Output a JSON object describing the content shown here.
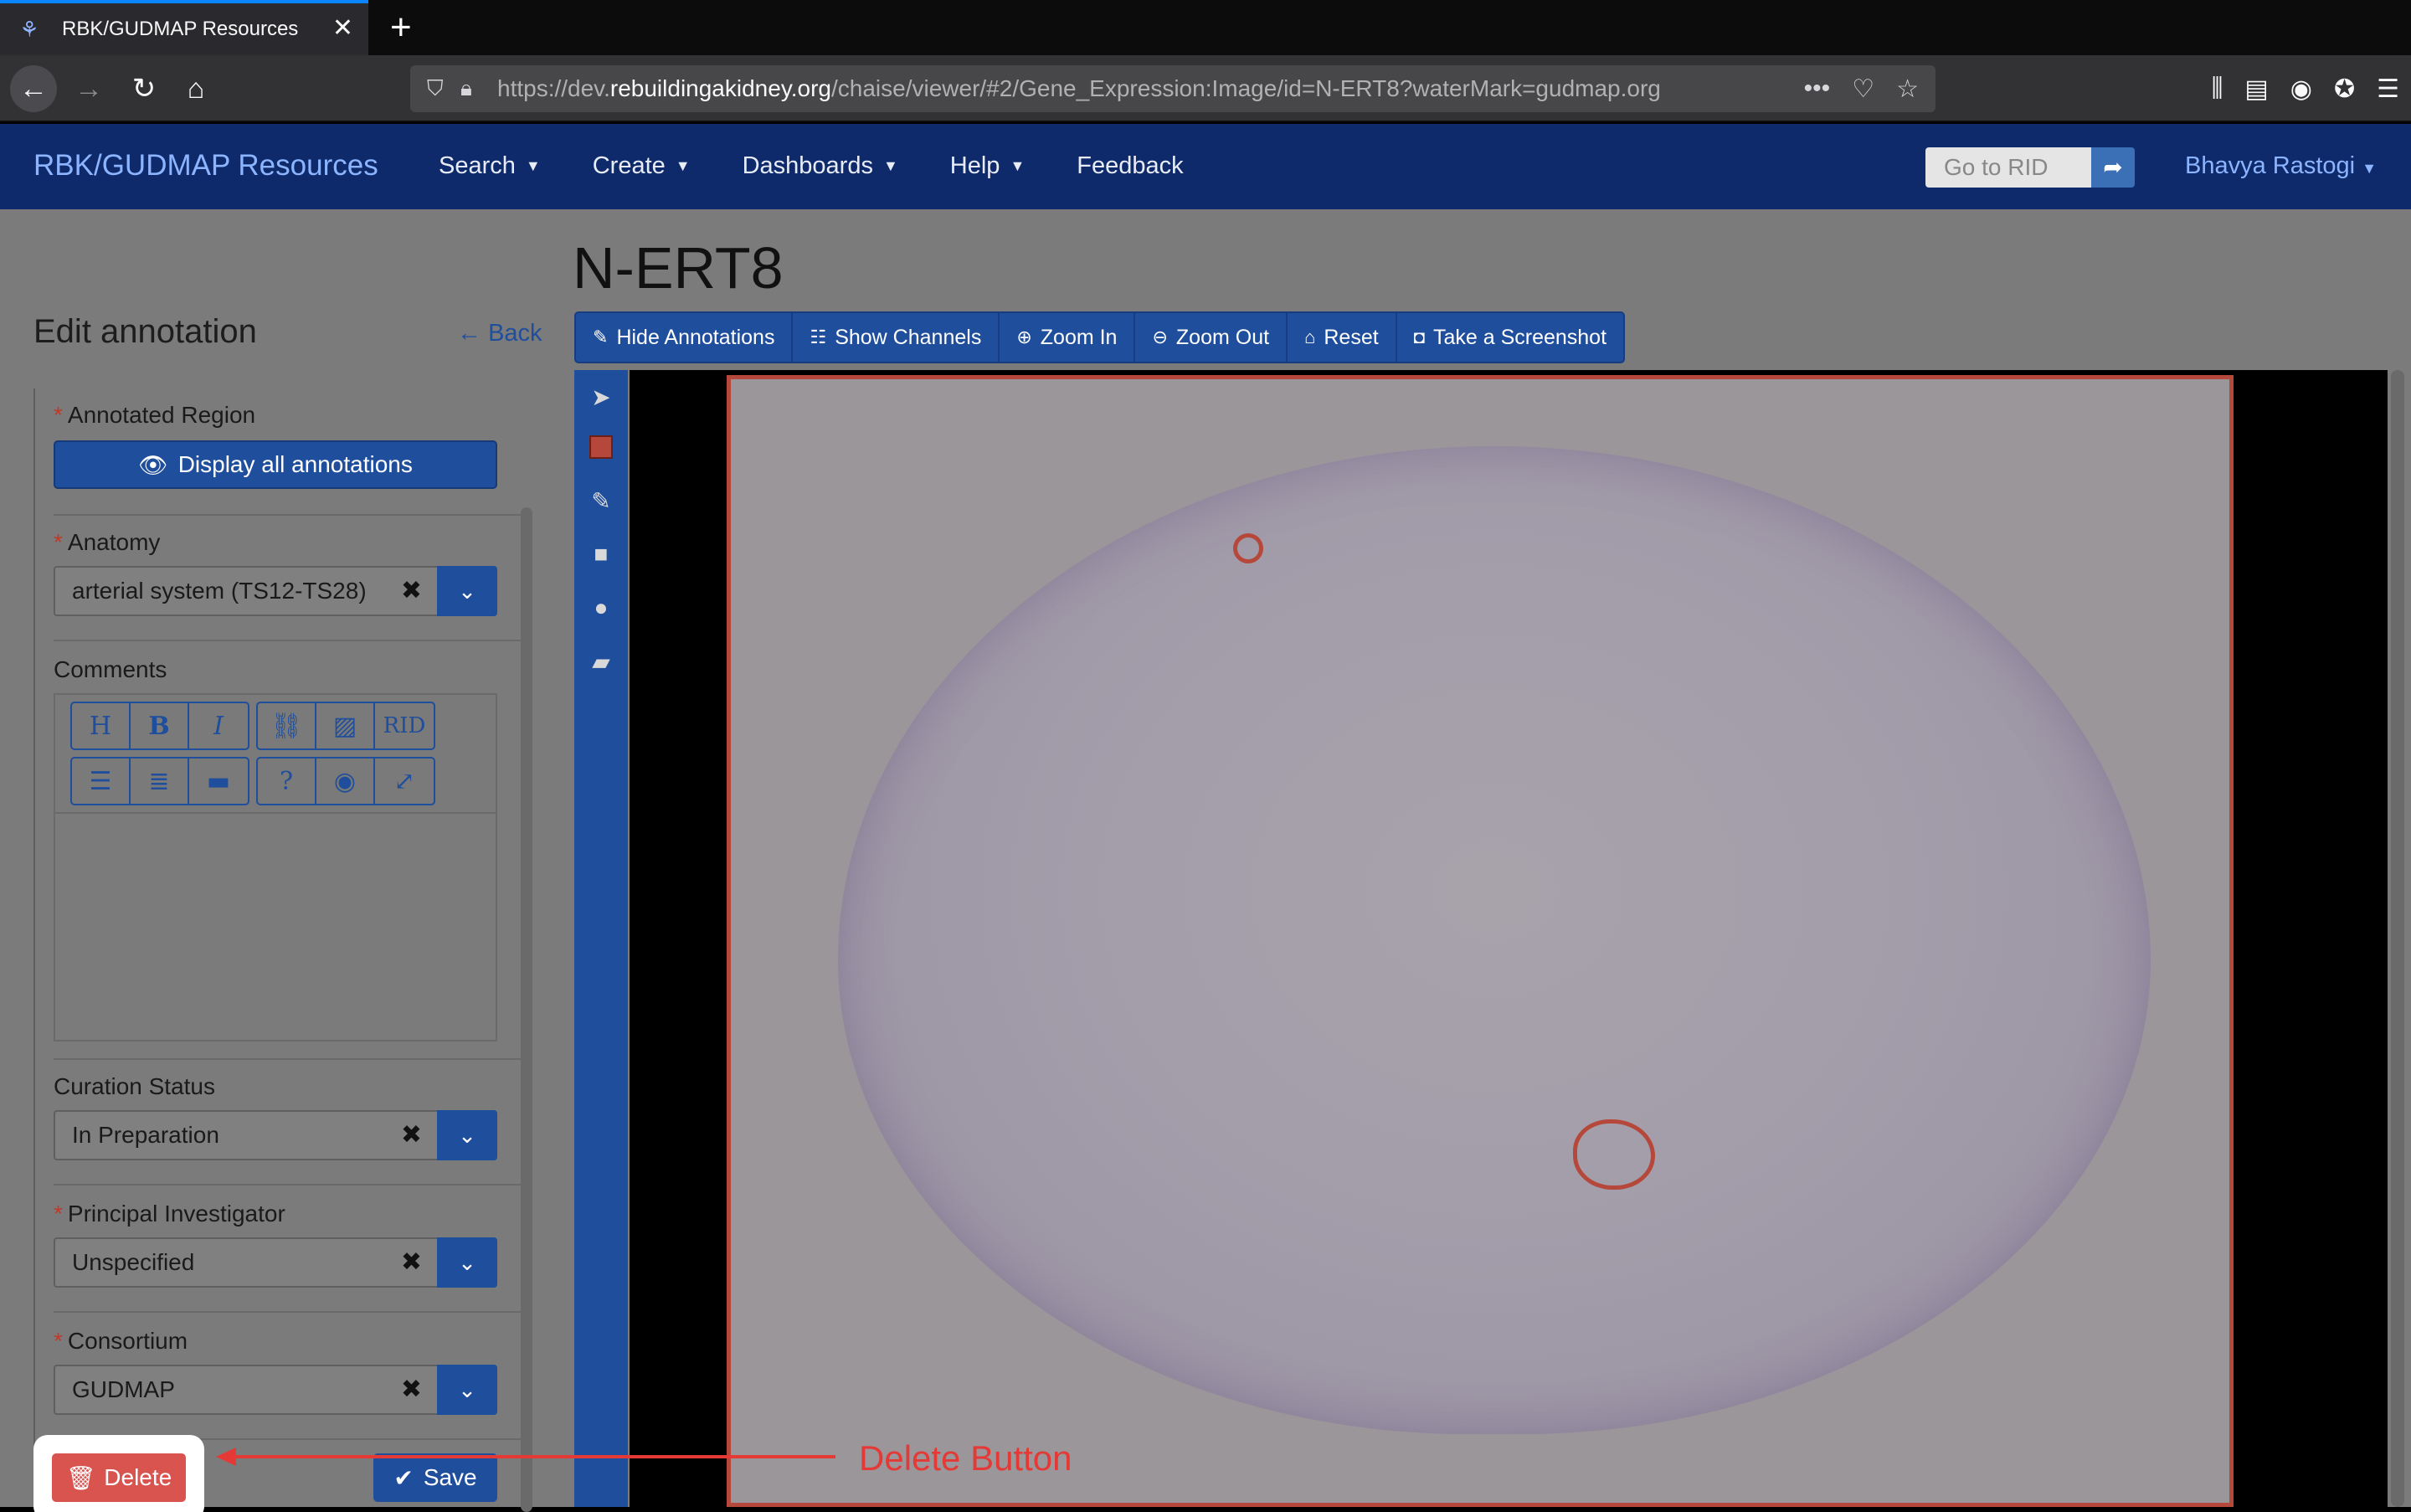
{
  "browser": {
    "tab_title": "RBK/GUDMAP Resources",
    "url_prefix": "https://dev.",
    "url_host": "rebuildingakidney.org",
    "url_path": "/chaise/viewer/#2/Gene_Expression:Image/id=N-ERT8?waterMark=gudmap.org"
  },
  "appnav": {
    "brand": "RBK/GUDMAP Resources",
    "menu": [
      {
        "label": "Search",
        "has_caret": true
      },
      {
        "label": "Create",
        "has_caret": true
      },
      {
        "label": "Dashboards",
        "has_caret": true
      },
      {
        "label": "Help",
        "has_caret": true
      },
      {
        "label": "Feedback",
        "has_caret": false
      }
    ],
    "rid_placeholder": "Go to RID",
    "user": "Bhavya Rastogi"
  },
  "page": {
    "title": "N-ERT8"
  },
  "edit_panel": {
    "title": "Edit annotation",
    "back_label": "Back",
    "annotated_region_label": "Annotated Region",
    "display_all_label": "Display all annotations",
    "anatomy_label": "Anatomy",
    "anatomy_value": "arterial system (TS12-TS28)",
    "comments_label": "Comments",
    "md_buttons_row1": [
      "H",
      "B",
      "I",
      "🔗",
      "🖼",
      "RID"
    ],
    "curation_label": "Curation Status",
    "curation_value": "In Preparation",
    "pi_label": "Principal Investigator",
    "pi_value": "Unspecified",
    "consortium_label": "Consortium",
    "consortium_value": "GUDMAP",
    "delete_label": "Delete",
    "save_label": "Save"
  },
  "viewer_toolbar": [
    {
      "label": "Hide Annotations",
      "icon": "edit-icon"
    },
    {
      "label": "Show Channels",
      "icon": "list-icon"
    },
    {
      "label": "Zoom In",
      "icon": "zoom-in-icon"
    },
    {
      "label": "Zoom Out",
      "icon": "zoom-out-icon"
    },
    {
      "label": "Reset",
      "icon": "home-icon"
    },
    {
      "label": "Take a Screenshot",
      "icon": "camera-icon"
    }
  ],
  "callout": {
    "label": "Delete Button",
    "color": "#e53935"
  }
}
